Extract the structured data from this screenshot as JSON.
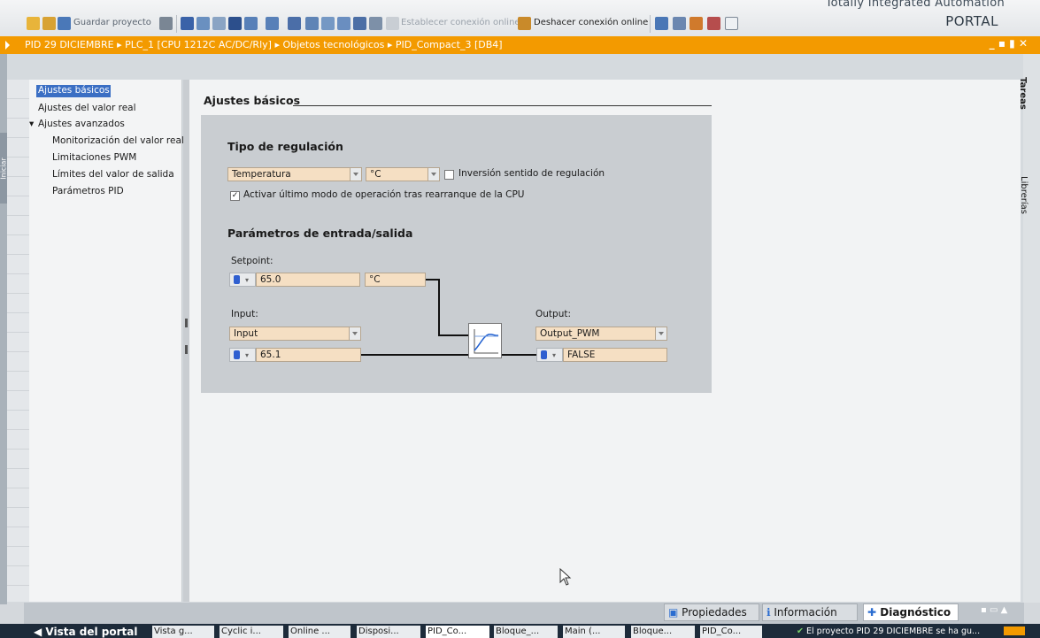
{
  "header": {
    "brand_line1": "Totally Integrated Automation",
    "brand_line2": "PORTAL",
    "save_label": "Guardar proyecto",
    "go_online": "Establecer conexión online",
    "go_offline": "Deshacer conexión online"
  },
  "breadcrumb": [
    "PID 29 DICIEMBRE",
    "PLC_1 [CPU 1212C AC/DC/Rly]",
    "Objetos tecnológicos",
    "PID_Compact_3 [DB4]"
  ],
  "left_tab": "Iniciar",
  "nav": {
    "items": [
      {
        "label": "Ajustes básicos",
        "selected": true
      },
      {
        "label": "Ajustes del valor real"
      },
      {
        "label": "Ajustes avanzados",
        "expanded": true
      },
      {
        "label": "Monitorización del valor real"
      },
      {
        "label": "Limitaciones PWM"
      },
      {
        "label": "Límites del valor de salida"
      },
      {
        "label": "Parámetros PID"
      }
    ]
  },
  "section_title": "Ajustes básicos",
  "regulation": {
    "title": "Tipo de regulación",
    "type_value": "Temperatura",
    "unit_value": "°C",
    "invert_label": "Inversión sentido de regulación",
    "invert_checked": false,
    "activate_label": "Activar último modo de operación tras rearranque de la CPU",
    "activate_checked": true
  },
  "io": {
    "title": "Parámetros de entrada/salida",
    "setpoint_label": "Setpoint:",
    "setpoint_value": "65.0",
    "setpoint_unit": "°C",
    "input_label": "Input:",
    "input_select": "Input",
    "input_value": "65.1",
    "output_label": "Output:",
    "output_select": "Output_PWM",
    "output_value": "FALSE"
  },
  "right_tabs": [
    "Tareas",
    "Librerías"
  ],
  "bottom_tabs": [
    "Propiedades",
    "Información",
    "Diagnóstico"
  ],
  "taskbar": {
    "portal_view": "Vista del portal",
    "items": [
      "Vista g...",
      "Cyclic i...",
      "Online ...",
      "Disposi...",
      "PID_Co...",
      "Bloque_...",
      "Main (...",
      "Bloque...",
      "PID_Co..."
    ],
    "status": "El proyecto PID 29 DICIEMBRE se ha gu..."
  },
  "colors": {
    "accent": "#f39a00",
    "field": "#f5dfc3",
    "panel": "#c9cdd1"
  }
}
